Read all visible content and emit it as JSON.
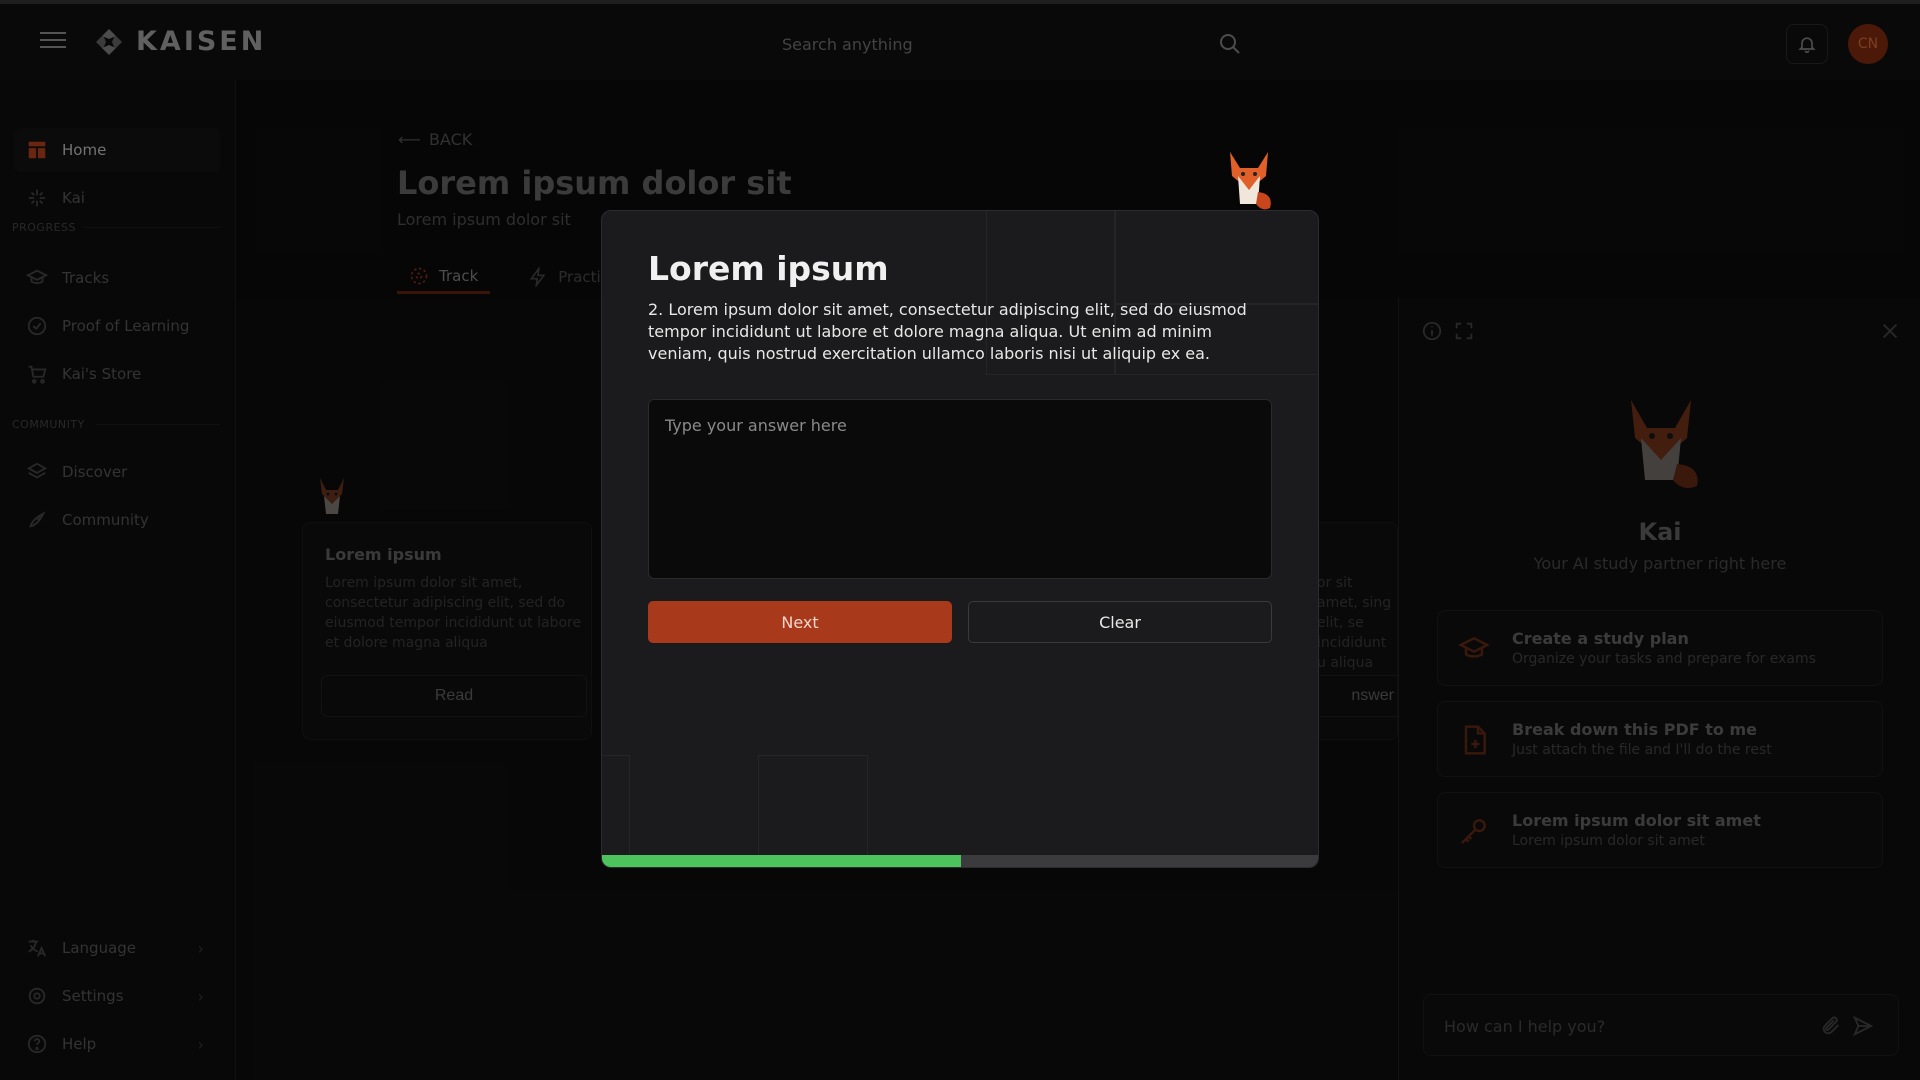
{
  "app": {
    "brand": "KAISEN",
    "avatar_initials": "CN"
  },
  "search": {
    "placeholder": "Search anything"
  },
  "sidebar": {
    "items": [
      {
        "label": "Home",
        "icon": "home-icon",
        "active": true
      },
      {
        "label": "Kai",
        "icon": "sparkle-icon"
      }
    ],
    "progress_label": "PROGRESS",
    "progress_items": [
      {
        "label": "Tracks",
        "icon": "graduation-cap-icon"
      },
      {
        "label": "Proof of Learning",
        "icon": "check-circle-icon"
      },
      {
        "label": "Kai's Store",
        "icon": "cart-icon"
      }
    ],
    "community_label": "COMMUNITY",
    "community_items": [
      {
        "label": "Discover",
        "icon": "layers-icon"
      },
      {
        "label": "Community",
        "icon": "rocket-icon"
      }
    ],
    "bottom_items": [
      {
        "label": "Language",
        "icon": "translate-icon"
      },
      {
        "label": "Settings",
        "icon": "gear-icon"
      },
      {
        "label": "Help",
        "icon": "help-circle-icon"
      }
    ]
  },
  "main": {
    "back_label": "BACK",
    "title": "Lorem ipsum dolor sit",
    "subtitle": "Lorem ipsum dolor sit",
    "tabs": [
      {
        "label": "Track",
        "active": true
      },
      {
        "label": "Practice"
      }
    ],
    "card_left": {
      "title": "Lorem ipsum",
      "desc": "Lorem ipsum dolor sit amet, consectetur adipiscing elit, sed do eiusmod tempor incididunt ut labore et dolore magna aliqua",
      "button": "Read"
    },
    "card_right": {
      "desc": "or sit amet, sing elit, se incididunt u aliqua",
      "button": "nswer"
    }
  },
  "kai_panel": {
    "name": "Kai",
    "tagline": "Your AI study partner right here",
    "actions": [
      {
        "title": "Create a study plan",
        "subtitle": "Organize your tasks and prepare for exams",
        "icon": "graduation-cap-icon"
      },
      {
        "title": "Break down this PDF to me",
        "subtitle": "Just attach the file and I'll do the rest",
        "icon": "file-plus-icon"
      },
      {
        "title": "Lorem ipsum dolor sit amet",
        "subtitle": "Lorem ipsum dolor sit amet",
        "icon": "key-icon"
      }
    ],
    "chat_placeholder": "How can I help you?"
  },
  "modal": {
    "title": "Lorem ipsum",
    "question": "2. Lorem ipsum dolor sit amet, consectetur adipiscing elit, sed do eiusmod tempor incididunt ut labore et dolore magna aliqua. Ut enim ad minim veniam, quis nostrud exercitation ullamco laboris nisi ut aliquip ex ea.",
    "answer_placeholder": "Type your answer here",
    "next_label": "Next",
    "clear_label": "Clear",
    "progress": 0.5
  },
  "colors": {
    "accent": "#a8391a",
    "progress": "#4cc35c",
    "background": "#0c0c0c"
  }
}
